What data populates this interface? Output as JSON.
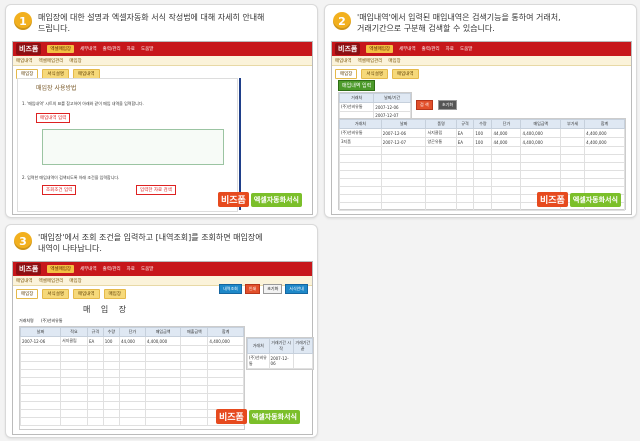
{
  "steps": [
    {
      "num": "1",
      "text": "매입장에 대한 설명과 엑셀자동화 서식 작성법에 대해 자세히 안내해\n드립니다."
    },
    {
      "num": "2",
      "text": "'매입내역'에서 입력된 매입내역은 검색기능을 통하여 거래처,\n거래기간으로 구분해 검색할 수 있습니다."
    },
    {
      "num": "3",
      "text": "'매입장'에서 조회 조건을 입력하고 [내역조회]를 조회하면 매입장에\n내역이 나타납니다."
    }
  ],
  "app": {
    "logo": "비즈폼",
    "nav": [
      "엑셀매입장",
      "세부내역",
      "출력/관리",
      "자료",
      "도움말",
      "입력"
    ],
    "subnav": [
      "매입내역",
      "엑셀매입관리",
      "매입장"
    ],
    "tabs": [
      "매입장",
      "서식설명",
      "매입내역",
      "매입장"
    ]
  },
  "shot1": {
    "guide_title": "매입장 사용방법",
    "line1": "1. '매입내역' 시트의 표를 참고하여 아래와 같이 매입 내역을 입력합니다.",
    "redbox1": "매입내역 입력",
    "line2": "2. 입력한 매입내역이 검색되도록 아래 조건을 입력합니다.",
    "redbox2": "조회조건 입력",
    "redbox3": "입력한 자료 검색"
  },
  "shot2": {
    "green_label": "매입내역 입력",
    "filter_headers": [
      "거래처",
      "날짜/기간",
      "날짜"
    ],
    "filter_values": [
      "(주)선비유통",
      "2007-12-06",
      "2007-12-07"
    ],
    "btn_search": "검 색",
    "btn_reset": "초기화",
    "columns": [
      "거래처",
      "날짜",
      "품명",
      "규격",
      "수량",
      "단가",
      "매입금액",
      "부가세",
      "합계"
    ],
    "rows": [
      [
        "(주)선비유통",
        "2007-12-06",
        "서지클립",
        "EA",
        "100",
        "44,000",
        "4,400,000",
        "",
        "4,400,000"
      ],
      [
        "3지품",
        "2007-12-07",
        "양곤유통",
        "EA",
        "100",
        "44,000",
        "4,400,000",
        "",
        "4,400,000"
      ]
    ]
  },
  "shot3": {
    "title": "매 입 장",
    "party_label": "거래처명",
    "party_value": "(주)선비유통",
    "columns": [
      "날짜",
      "적요",
      "규격",
      "수량",
      "단가",
      "매입금액",
      "매출금액",
      "합계"
    ],
    "rows": [
      [
        "2007-12-06",
        "서지클립",
        "EA",
        "100",
        "44,000",
        "4,400,000",
        "",
        "4,400,000"
      ]
    ],
    "side_headers": [
      "거래처",
      "거래기간 시작",
      "거래기간 끝"
    ],
    "side_values": [
      "(주)선비유통",
      "2007-12-06",
      ""
    ],
    "buttons": [
      "내역조회",
      "인쇄",
      "초기화",
      "서식안내"
    ]
  },
  "badge": {
    "part1": "비즈폼",
    "part2": "엑셀자동화서식"
  }
}
